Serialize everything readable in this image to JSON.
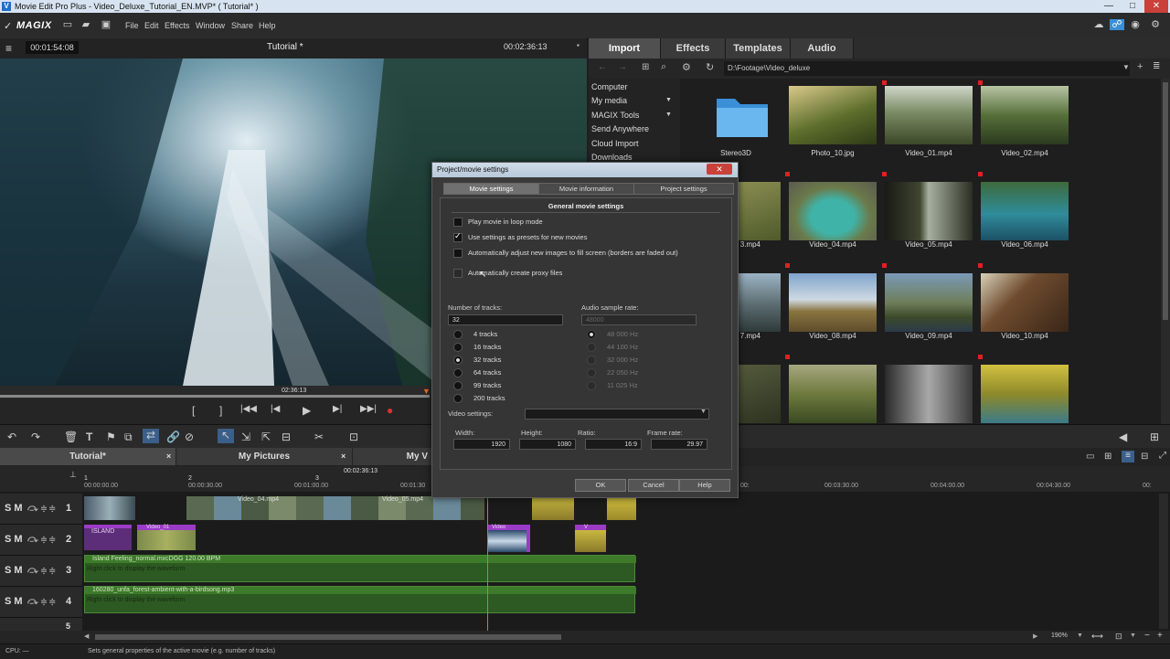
{
  "window": {
    "title": "Movie Edit Pro Plus - Video_Deluxe_Tutorial_EN.MVP* ( Tutorial* )",
    "controls": [
      "—",
      "□",
      "✕"
    ]
  },
  "menubar": {
    "logo": "MAGIX",
    "items": [
      "File",
      "Edit",
      "Effects",
      "Window",
      "Share",
      "Help"
    ]
  },
  "preview": {
    "timecode_left": "00:01:54:08",
    "title": "Tutorial *",
    "timecode_right": "00:02:36:13",
    "scrub_time": "02:36:13"
  },
  "transport": [
    "[",
    "]",
    "|◀◀",
    "|◀",
    "▶",
    "▶|",
    "▶▶|",
    "●"
  ],
  "right_panel": {
    "tabs": [
      "Import",
      "Effects",
      "Templates",
      "Audio"
    ],
    "active_tab": "Import",
    "path": "D:\\Footage\\Video_deluxe",
    "nav_items": [
      "Computer",
      "My media",
      "MAGIX Tools",
      "Send Anywhere",
      "Cloud Import",
      "Downloads"
    ],
    "files": [
      {
        "name": "Stereo3D"
      },
      {
        "name": "Photo_10.jpg"
      },
      {
        "name": "Video_01.mp4"
      },
      {
        "name": "Video_02.mp4"
      },
      {
        "name": "3.mp4"
      },
      {
        "name": "Video_04.mp4"
      },
      {
        "name": "Video_05.mp4"
      },
      {
        "name": "Video_06.mp4"
      },
      {
        "name": "7.mp4"
      },
      {
        "name": "Video_08.mp4"
      },
      {
        "name": "Video_09.mp4"
      },
      {
        "name": "Video_10.mp4"
      }
    ]
  },
  "project_tabs": [
    "Tutorial*",
    "My Pictures",
    "My V"
  ],
  "ruler": {
    "current": "00:02:36:13",
    "ticks": [
      "00:00:00.00",
      "00:00:30.00",
      "00:01:00.00",
      "00:01:30",
      "00:",
      "00:03:30.00",
      "00:04:00.00",
      "00:04:30.00",
      "00:"
    ],
    "markers": [
      "1",
      "2",
      "3"
    ]
  },
  "tracks": [
    {
      "num": "1",
      "controls": "S M"
    },
    {
      "num": "2",
      "controls": "S M"
    },
    {
      "num": "3",
      "controls": "S M"
    },
    {
      "num": "4",
      "controls": "S M"
    },
    {
      "num": "5",
      "controls": ""
    }
  ],
  "clips": {
    "track1_labels": [
      "Video_04.mp4",
      "Video_05.mp4"
    ],
    "track2_labels": [
      "ISLAND",
      "Video_01",
      "Video",
      "V"
    ],
    "audio3_name": "Island Feeling_normal.mxcDGG  120.00 BPM",
    "audio3_hint": "Right click to display the waveform",
    "audio4_name": "160280_unfa_forest-ambient-with-a-birdsong.mp3",
    "audio4_hint": "Right click to display the waveform"
  },
  "zoom": "190%",
  "status": {
    "cpu": "CPU: —",
    "message": "Sets general properties of the active movie (e.g. number of tracks)"
  },
  "dialog": {
    "title": "Project/movie settings",
    "tabs": [
      "Movie settings",
      "Movie information",
      "Project settings"
    ],
    "active_tab": "Movie settings",
    "section_title": "General movie settings",
    "checkboxes": [
      {
        "label": "Play movie in loop mode",
        "checked": false
      },
      {
        "label": "Use settings as presets for new movies",
        "checked": true
      },
      {
        "label": "Automatically adjust new images to fill screen (borders are faded out)",
        "checked": false
      },
      {
        "label": "Automatically create proxy files",
        "checked": false
      }
    ],
    "tracks_label": "Number of tracks:",
    "tracks_value": "32",
    "track_options": [
      "4 tracks",
      "16 tracks",
      "32 tracks",
      "64 tracks",
      "99 tracks",
      "200 tracks"
    ],
    "track_selected": "32 tracks",
    "sample_label": "Audio sample rate:",
    "sample_value": "48000",
    "sample_options": [
      "48 000 Hz",
      "44 100 Hz",
      "32 000 Hz",
      "22 050 Hz",
      "11 025 Hz"
    ],
    "video_settings_label": "Video settings:",
    "width_label": "Width:",
    "width_value": "1920",
    "height_label": "Height:",
    "height_value": "1080",
    "ratio_label": "Ratio:",
    "ratio_value": "16:9",
    "framerate_label": "Frame rate:",
    "framerate_value": "29.97",
    "buttons": {
      "ok": "OK",
      "cancel": "Cancel",
      "help": "Help"
    },
    "close": "✕"
  },
  "colors": {
    "accent": "#3a8fd6",
    "record": "#e03030",
    "video_clip": "#5d6b80",
    "photo_clip": "#9b3cc7",
    "audio_clip": "#3d7a2a",
    "playhead": "#e0702a"
  }
}
